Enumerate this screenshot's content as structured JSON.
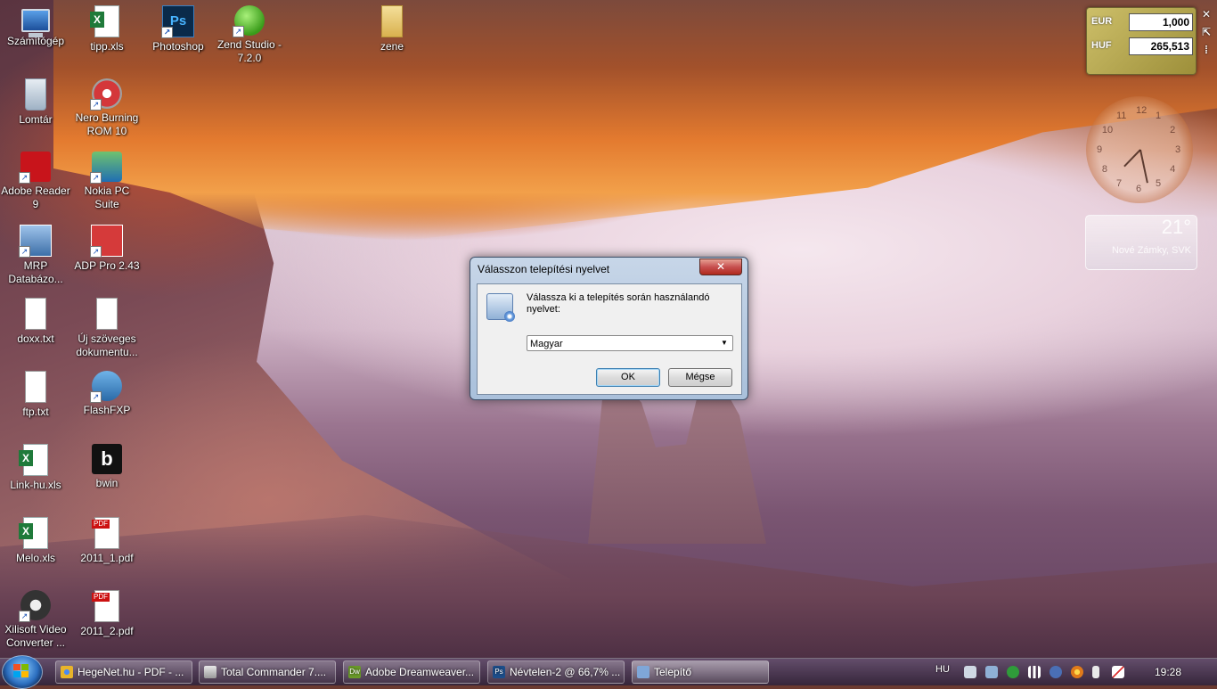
{
  "desktop": {
    "icons": [
      {
        "label": "Számítógép",
        "icon": "computer-icon"
      },
      {
        "label": "tipp.xls",
        "icon": "excel-file-icon"
      },
      {
        "label": "Photoshop",
        "icon": "photoshop-icon",
        "glyph": "Ps"
      },
      {
        "label": "Zend Studio - 7.2.0",
        "icon": "zend-studio-icon"
      },
      {
        "label": "zene",
        "icon": "folder-icon"
      },
      {
        "label": "Lomtár",
        "icon": "recycle-bin-icon"
      },
      {
        "label": "Nero Burning ROM 10",
        "icon": "nero-icon"
      },
      {
        "label": "Adobe Reader 9",
        "icon": "adobe-reader-icon"
      },
      {
        "label": "Nokia PC Suite",
        "icon": "nokia-pc-suite-icon"
      },
      {
        "label": "MRP Databázo...",
        "icon": "mrp-shortcut-icon"
      },
      {
        "label": "ADP Pro 2.43",
        "icon": "adp-pro-icon"
      },
      {
        "label": "doxx.txt",
        "icon": "text-file-icon"
      },
      {
        "label": "Új szöveges dokumentu...",
        "icon": "text-file-icon"
      },
      {
        "label": "ftp.txt",
        "icon": "text-file-icon"
      },
      {
        "label": "FlashFXP",
        "icon": "flashfxp-icon"
      },
      {
        "label": "Link-hu.xls",
        "icon": "excel-file-icon"
      },
      {
        "label": "bwin",
        "icon": "bwin-icon",
        "glyph": "b"
      },
      {
        "label": "Melo.xls",
        "icon": "excel-file-icon"
      },
      {
        "label": "2011_1.pdf",
        "icon": "pdf-file-icon"
      },
      {
        "label": "Xilisoft Video Converter ...",
        "icon": "xilisoft-icon"
      },
      {
        "label": "2011_2.pdf",
        "icon": "pdf-file-icon"
      }
    ],
    "shortcut_arrow": "↗"
  },
  "dialog": {
    "title": "Válasszon telepítési nyelvet",
    "close_glyph": "✕",
    "message": "Válassza ki a telepítés során használandó nyelvet:",
    "language_selected": "Magyar",
    "dropdown_glyph": "▼",
    "ok_label": "OK",
    "cancel_label": "Mégse"
  },
  "gadgets": {
    "currency": {
      "from_code": "EUR",
      "from_value": "1,000",
      "to_code": "HUF",
      "to_value": "265,513"
    },
    "controls": {
      "close_glyph": "✕",
      "size_glyph": "⇱",
      "drag_glyph": "⁞"
    },
    "clock": {
      "numbers": [
        "12",
        "1",
        "2",
        "3",
        "4",
        "5",
        "6",
        "7",
        "8",
        "9",
        "10",
        "11"
      ],
      "hour": 7,
      "minute": 28
    },
    "weather": {
      "temperature": "21°",
      "location": "Nové Zámky, SVK"
    }
  },
  "taskbar": {
    "tasks": [
      {
        "label": "HegeNet.hu - PDF - ...",
        "color": "#e8b42a",
        "active": false
      },
      {
        "label": "Total Commander 7....",
        "color": "#c0c0c0",
        "active": false
      },
      {
        "label": "Adobe Dreamweaver...",
        "color": "#6a9a2a",
        "active": false,
        "glyph": "Dw"
      },
      {
        "label": "Névtelen-2 @ 66,7% ...",
        "color": "#1d4e8a",
        "active": false,
        "glyph": "Ps"
      },
      {
        "label": "Telepítő",
        "color": "#7fa7d8",
        "active": true
      }
    ],
    "language": "HU",
    "time": "19:28",
    "colors": {
      "accent": "#2c6fc0"
    }
  }
}
